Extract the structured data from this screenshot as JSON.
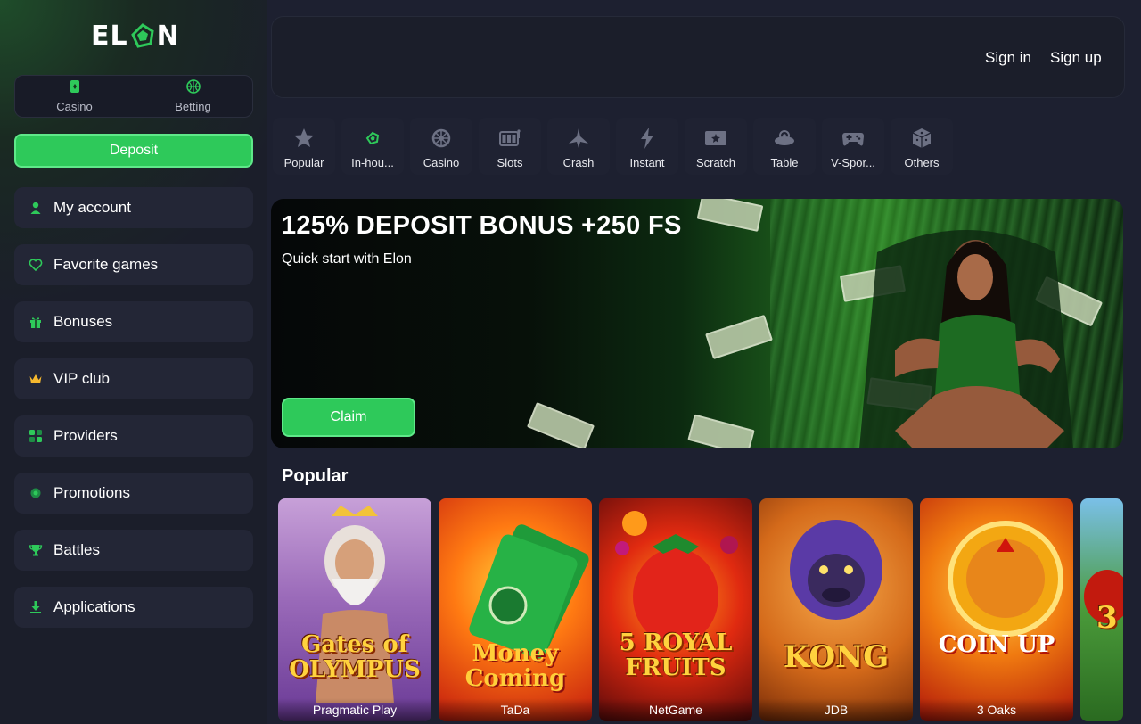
{
  "brand": {
    "logo_text_left": "EL",
    "logo_text_right": "N",
    "accent": "#2ec95a"
  },
  "mode_switch": [
    {
      "label": "Casino",
      "icon": "card-icon"
    },
    {
      "label": "Betting",
      "icon": "ball-icon"
    }
  ],
  "deposit_label": "Deposit",
  "menu": [
    {
      "label": "My account",
      "icon": "user-icon"
    },
    {
      "label": "Favorite games",
      "icon": "heart-icon"
    },
    {
      "label": "Bonuses",
      "icon": "gift-icon"
    },
    {
      "label": "VIP club",
      "icon": "crown-icon"
    },
    {
      "label": "Providers",
      "icon": "grid-icon"
    },
    {
      "label": "Promotions",
      "icon": "promo-icon"
    },
    {
      "label": "Battles",
      "icon": "trophy-icon"
    },
    {
      "label": "Applications",
      "icon": "download-icon"
    }
  ],
  "header": {
    "sign_in": "Sign in",
    "sign_up": "Sign up"
  },
  "categories": [
    {
      "label": "Popular",
      "icon": "star-icon"
    },
    {
      "label": "In-hou...",
      "icon": "elon-logo-icon"
    },
    {
      "label": "Casino",
      "icon": "roulette-icon"
    },
    {
      "label": "Slots",
      "icon": "slots-icon"
    },
    {
      "label": "Crash",
      "icon": "plane-icon"
    },
    {
      "label": "Instant",
      "icon": "lightning-icon"
    },
    {
      "label": "Scratch",
      "icon": "scratch-icon"
    },
    {
      "label": "Table",
      "icon": "table-icon"
    },
    {
      "label": "V-Spor...",
      "icon": "gamepad-icon"
    },
    {
      "label": "Others",
      "icon": "dice-icon"
    }
  ],
  "banner": {
    "title": "125% DEPOSIT BONUS +250 FS",
    "subtitle": "Quick start with Elon",
    "cta": "Claim"
  },
  "popular": {
    "title": "Popular",
    "games": [
      {
        "title": "Gates of OLYMPUS",
        "provider": "Pragmatic Play"
      },
      {
        "title": "Money Coming",
        "provider": "TaDa"
      },
      {
        "title": "5 ROYAL FRUITS",
        "provider": "NetGame"
      },
      {
        "title": "KONG",
        "provider": "JDB"
      },
      {
        "title": "COIN UP",
        "provider": "3 Oaks"
      },
      {
        "title": "3",
        "provider": ""
      }
    ]
  }
}
